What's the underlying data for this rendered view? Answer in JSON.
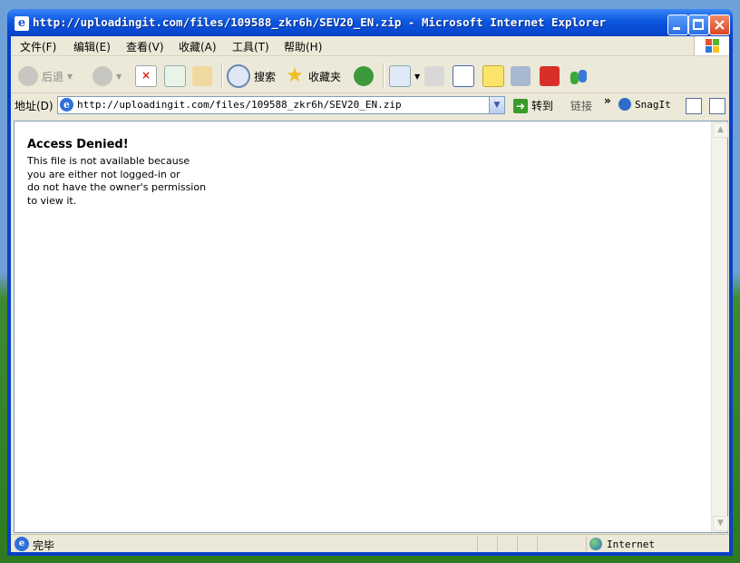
{
  "window": {
    "title": "http://uploadingit.com/files/109588_zkr6h/SEV20_EN.zip - Microsoft Internet Explorer"
  },
  "menu": [
    {
      "label": "文件(F)"
    },
    {
      "label": "编辑(E)"
    },
    {
      "label": "查看(V)"
    },
    {
      "label": "收藏(A)"
    },
    {
      "label": "工具(T)"
    },
    {
      "label": "帮助(H)"
    }
  ],
  "toolbar": {
    "back_label": "后退",
    "search_label": "搜索",
    "favorites_label": "收藏夹"
  },
  "address": {
    "label": "地址(D)",
    "url": "http://uploadingit.com/files/109588_zkr6h/SEV20_EN.zip",
    "go_label": "转到",
    "links_label": "链接",
    "snagit_label": "SnagIt"
  },
  "page": {
    "heading": "Access Denied!",
    "message": "This file is not available because\nyou are either not logged-in or\ndo not have the owner's permission\nto view it."
  },
  "status": {
    "text": "完毕",
    "zone": "Internet"
  },
  "colors": {
    "titlebar": "#0c56e0",
    "chrome": "#ece9d8",
    "close_button": "#d8461e"
  }
}
